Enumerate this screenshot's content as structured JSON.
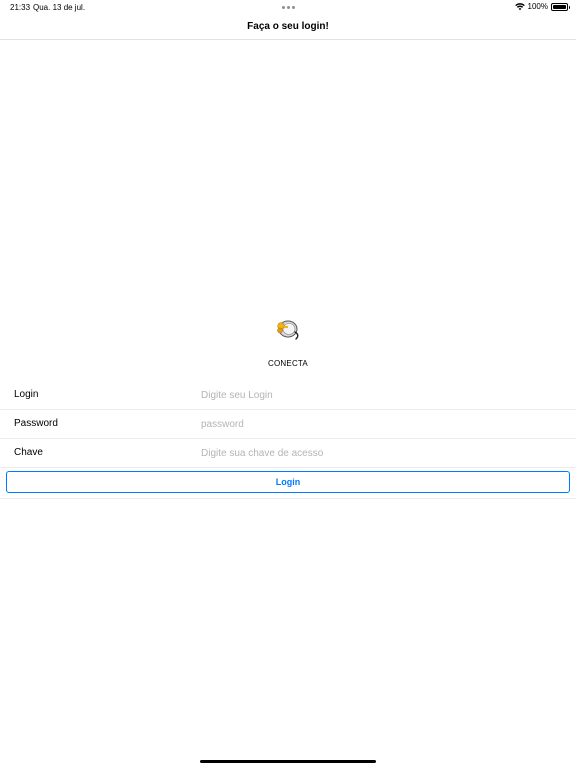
{
  "status_bar": {
    "time": "21:33",
    "date": "Qua. 13 de jul.",
    "battery": "100%",
    "wifi_icon": "wifi-icon",
    "battery_icon": "battery-icon"
  },
  "nav": {
    "title": "Faça o seu login!"
  },
  "app": {
    "name": "CONECTA",
    "logo_icon": "conecta-logo-icon"
  },
  "form": {
    "login_label": "Login",
    "login_placeholder": "Digite seu Login",
    "password_label": "Password",
    "password_placeholder": "password",
    "key_label": "Chave",
    "key_placeholder": "Digite sua chave de acesso",
    "submit_label": "Login"
  },
  "colors": {
    "accent": "#007aff",
    "placeholder": "#b4b4b8",
    "divider": "#ececee"
  }
}
